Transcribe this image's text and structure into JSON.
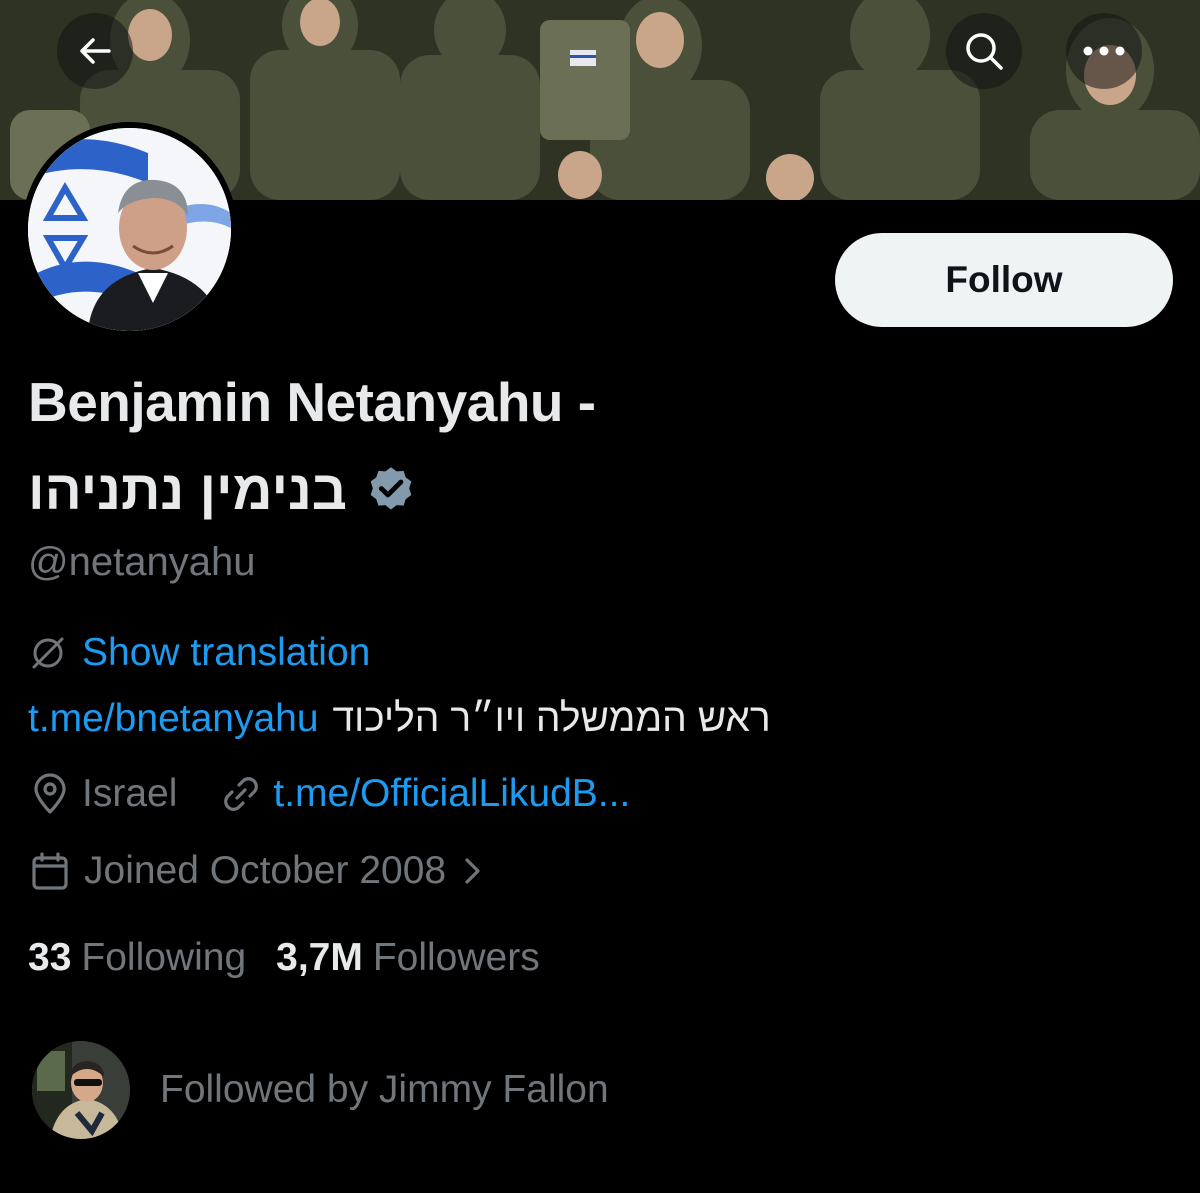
{
  "nav": {
    "back_icon": "arrow-left-icon",
    "search_icon": "search-icon",
    "more_icon": "more-horizontal-icon"
  },
  "profile": {
    "follow_label": "Follow",
    "name_line1": "Benjamin Netanyahu -",
    "name_line2": "בנימין נתניהו",
    "verified_icon": "verified-badge-icon",
    "verified_color": "#829aab",
    "handle": "@netanyahu"
  },
  "translation": {
    "icon": "globe-slash-icon",
    "label": "Show translation"
  },
  "bio": {
    "link": "t.me/bnetanyahu",
    "text": "ראש הממשלה ויו״ר הליכוד"
  },
  "meta": {
    "location_icon": "location-pin-icon",
    "location": "Israel",
    "link_icon": "link-icon",
    "website": "t.me/OfficialLikudB...",
    "calendar_icon": "calendar-icon",
    "joined": "Joined October 2008",
    "chevron_icon": "chevron-right-icon"
  },
  "stats": {
    "following_count": "33",
    "following_label": "Following",
    "followers_count": "3,7M",
    "followers_label": "Followers"
  },
  "followed_by": {
    "text": "Followed by Jimmy Fallon"
  },
  "colors": {
    "background": "#000000",
    "primary_text": "#e7e9ea",
    "secondary_text": "#71767b",
    "link": "#1d9bf0",
    "follow_button_bg": "#eff3f4"
  }
}
